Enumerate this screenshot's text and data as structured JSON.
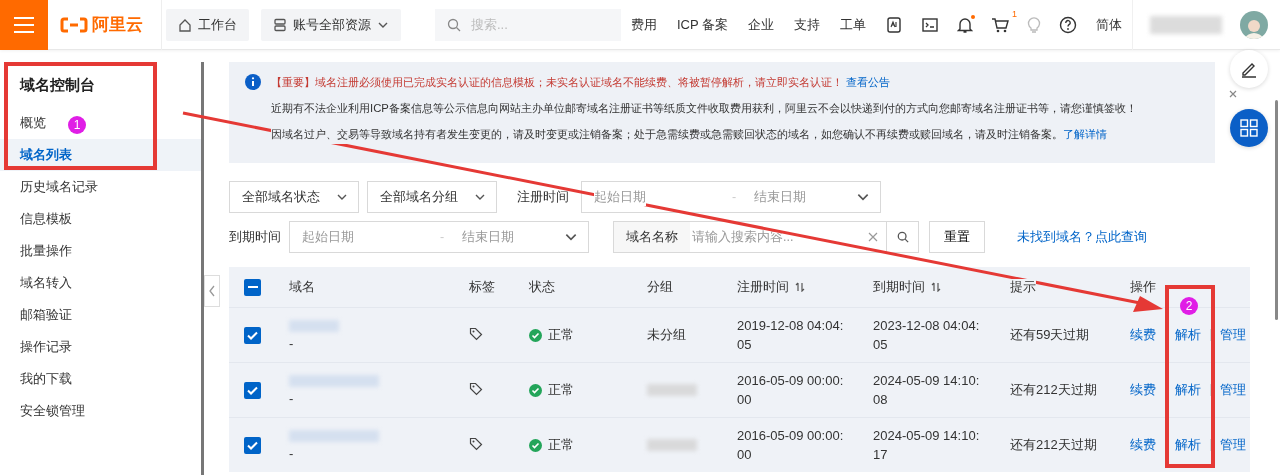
{
  "topbar": {
    "logo": "阿里云",
    "workbench": "工作台",
    "resources": "账号全部资源",
    "search": {
      "placeholder": "搜索..."
    },
    "nav": [
      "费用",
      "ICP 备案",
      "企业",
      "支持",
      "工单"
    ],
    "cart_badge": "1",
    "language": "简体"
  },
  "sidebar": {
    "title": "域名控制台",
    "items": [
      {
        "label": "概览",
        "selected": false
      },
      {
        "label": "域名列表",
        "selected": true
      },
      {
        "label": "历史域名记录",
        "selected": false
      },
      {
        "label": "信息模板",
        "selected": false
      },
      {
        "label": "批量操作",
        "selected": false
      },
      {
        "label": "域名转入",
        "selected": false
      },
      {
        "label": "邮箱验证",
        "selected": false
      },
      {
        "label": "操作记录",
        "selected": false
      },
      {
        "label": "我的下载",
        "selected": false
      },
      {
        "label": "安全锁管理",
        "selected": false
      }
    ]
  },
  "notice": {
    "important": "【重要】域名注册必须使用已完成实名认证的信息模板；未实名认证域名不能续费、将被暂停解析，请立即实名认证！",
    "important_link": "查看公告",
    "line_2": "近期有不法企业利用ICP备案信息等公示信息向网站主办单位邮寄域名注册证书等纸质文件收取费用获利，阿里云不会以快递到付的方式向您邮寄域名注册证书等，请您谨慎签收！",
    "line_3": "因域名过户、交易等导致域名持有者发生变更的，请及时变更或注销备案；处于急需续费或急需赎回状态的域名，如您确认不再续费或赎回域名，请及时注销备案。",
    "line_3_link": "了解详情"
  },
  "filters": {
    "status_select": "全部域名状态",
    "group_select": "全部域名分组",
    "registered_label": "注册时间",
    "registered_range": {
      "start_placeholder": "起始日期",
      "separator": "-",
      "end_placeholder": "结束日期"
    },
    "expires_label": "到期时间",
    "expires_range": {
      "start_placeholder": "起始日期",
      "separator": "-",
      "end_placeholder": "结束日期"
    },
    "search_prefix": "域名名称",
    "search": {
      "placeholder": "请输入搜索内容..."
    },
    "reset": "重置",
    "not_found_link": "未找到域名？点此查询"
  },
  "table": {
    "select_all": {
      "indeterminate": true
    },
    "columns": [
      "域名",
      "标签",
      "状态",
      "分组",
      "注册时间",
      "到期时间",
      "提示",
      "操作"
    ],
    "rows": [
      {
        "checked": true,
        "note": "-",
        "status": "正常",
        "group": "未分组",
        "registered": "2019-12-08 04:04:05",
        "expires": "2023-12-08 04:04:05",
        "hint": "还有59天过期",
        "actions": [
          "续费",
          "解析",
          "管理"
        ]
      },
      {
        "checked": true,
        "note": "-",
        "status": "正常",
        "group": null,
        "registered": "2016-05-09 00:00:00",
        "expires": "2024-05-09 14:10:08",
        "hint": "还有212天过期",
        "actions": [
          "续费",
          "解析",
          "管理"
        ]
      },
      {
        "checked": true,
        "note": "-",
        "status": "正常",
        "group": null,
        "registered": "2016-05-09 00:00:00",
        "expires": "2024-05-09 14:10:17",
        "hint": "还有212天过期",
        "actions": [
          "续费",
          "解析",
          "管理"
        ]
      }
    ]
  },
  "annotation_marks": [
    "1",
    "2"
  ]
}
